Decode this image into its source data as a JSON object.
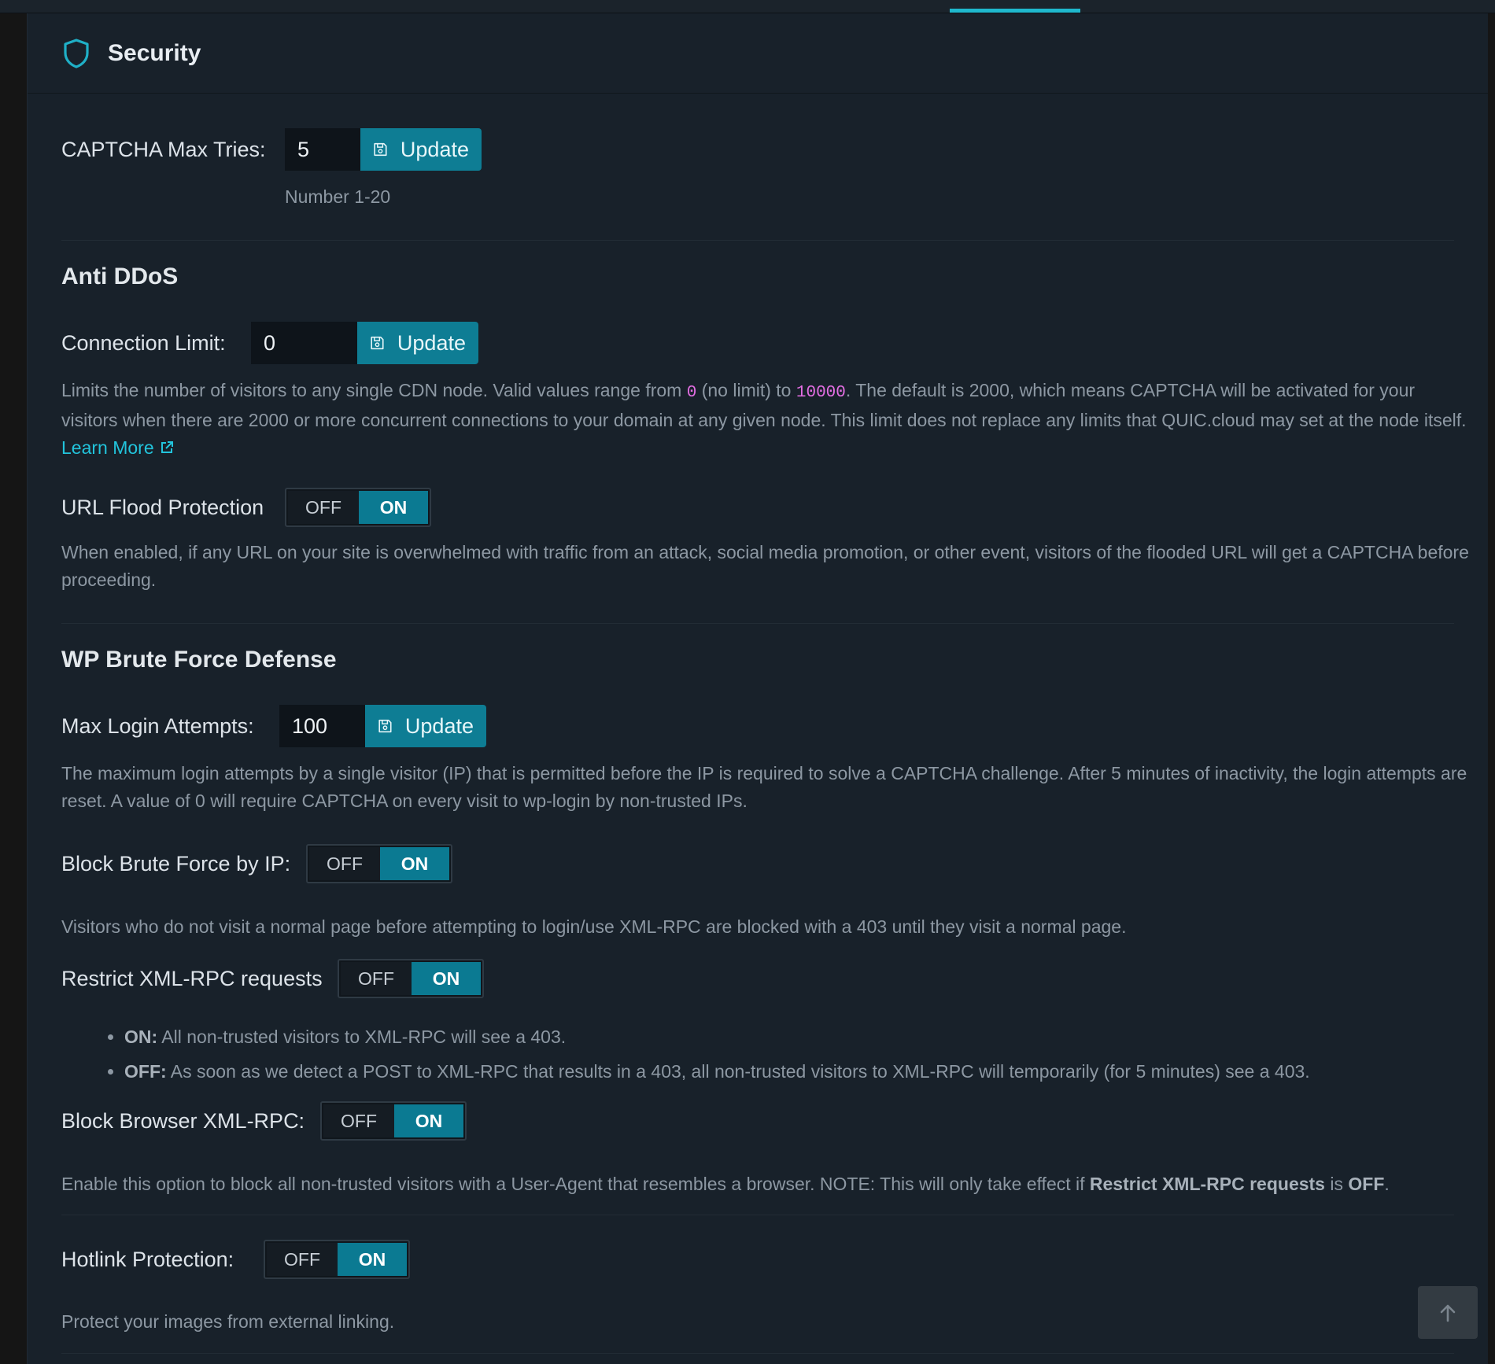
{
  "panel": {
    "title": "Security"
  },
  "captcha": {
    "label": "CAPTCHA Max Tries:",
    "value": "5",
    "update_label": "Update",
    "hint": "Number 1-20"
  },
  "anti_ddos": {
    "title": "Anti DDoS",
    "connection_limit": {
      "label": "Connection Limit:",
      "value": "0",
      "update_label": "Update",
      "desc_1": "Limits the number of visitors to any single CDN node. Valid values range from ",
      "min_code": "0",
      "desc_2": " (no limit) to ",
      "max_code": "10000",
      "desc_3": ". The default is 2000, which means CAPTCHA will be activated for your visitors when there are 2000 or more concurrent connections to your domain at any given node. This limit does not replace any limits that QUIC.cloud may set at the node itself. ",
      "learn_more": "Learn More"
    },
    "url_flood": {
      "label": "URL Flood Protection",
      "off": "OFF",
      "on": "ON",
      "desc": "When enabled, if any URL on your site is overwhelmed with traffic from an attack, social media promotion, or other event, visitors of the flooded URL will get a CAPTCHA before proceeding."
    }
  },
  "brute_force": {
    "title": "WP Brute Force Defense",
    "max_login": {
      "label": "Max Login Attempts:",
      "value": "100",
      "update_label": "Update",
      "desc": "The maximum login attempts by a single visitor (IP) that is permitted before the IP is required to solve a CAPTCHA challenge. After 5 minutes of inactivity, the login attempts are reset. A value of 0 will require CAPTCHA on every visit to wp-login by non-trusted IPs."
    },
    "block_by_ip": {
      "label": "Block Brute Force by IP:",
      "off": "OFF",
      "on": "ON",
      "desc": "Visitors who do not visit a normal page before attempting to login/use XML-RPC are blocked with a 403 until they visit a normal page."
    },
    "restrict_xmlrpc": {
      "label": "Restrict XML-RPC requests",
      "off": "OFF",
      "on": "ON",
      "bullet_on_key": "ON:",
      "bullet_on_text": " All non-trusted visitors to XML-RPC will see a 403.",
      "bullet_off_key": "OFF:",
      "bullet_off_text": " As soon as we detect a POST to XML-RPC that results in a 403, all non-trusted visitors to XML-RPC will temporarily (for 5 minutes) see a 403."
    },
    "block_browser_xmlrpc": {
      "label": "Block Browser XML-RPC:",
      "off": "OFF",
      "on": "ON",
      "desc_1": "Enable this option to block all non-trusted visitors with a User-Agent that resembles a browser. NOTE: This will only take effect if ",
      "desc_bold_1": "Restrict XML-RPC requests",
      "desc_2": " is ",
      "desc_bold_2": "OFF",
      "desc_3": "."
    }
  },
  "hotlink": {
    "label": "Hotlink Protection:",
    "off": "OFF",
    "on": "ON",
    "desc": "Protect your images from external linking."
  },
  "icons": {
    "header": "shield-icon",
    "update": "save-icon",
    "external": "external-link-icon",
    "scroll": "arrow-up-icon"
  },
  "colors": {
    "accent": "#1fb8cd",
    "button": "#0e7d94",
    "toggle_on": "#0b7a92",
    "code": "#e36ee2"
  }
}
